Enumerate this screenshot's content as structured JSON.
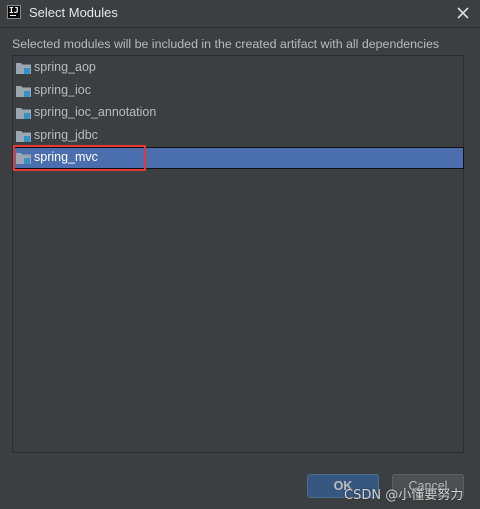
{
  "window": {
    "title": "Select Modules",
    "app_icon": "intellij-icon",
    "close_icon": "close-icon"
  },
  "dialog": {
    "hint": "Selected modules will be included in the created artifact with all dependencies",
    "modules": [
      {
        "label": "spring_aop",
        "icon": "module-folder-icon",
        "selected": false
      },
      {
        "label": "spring_ioc",
        "icon": "module-folder-icon",
        "selected": false
      },
      {
        "label": "spring_ioc_annotation",
        "icon": "module-folder-icon",
        "selected": false
      },
      {
        "label": "spring_jdbc",
        "icon": "module-folder-icon",
        "selected": false
      },
      {
        "label": "spring_mvc",
        "icon": "module-folder-icon",
        "selected": true
      }
    ],
    "ok_label": "OK",
    "cancel_label": "Cancel"
  },
  "watermark": "CSDN @小懂要努力",
  "colors": {
    "background": "#3c3f41",
    "selection": "#4b6eaf",
    "highlight_box": "#e53935"
  }
}
